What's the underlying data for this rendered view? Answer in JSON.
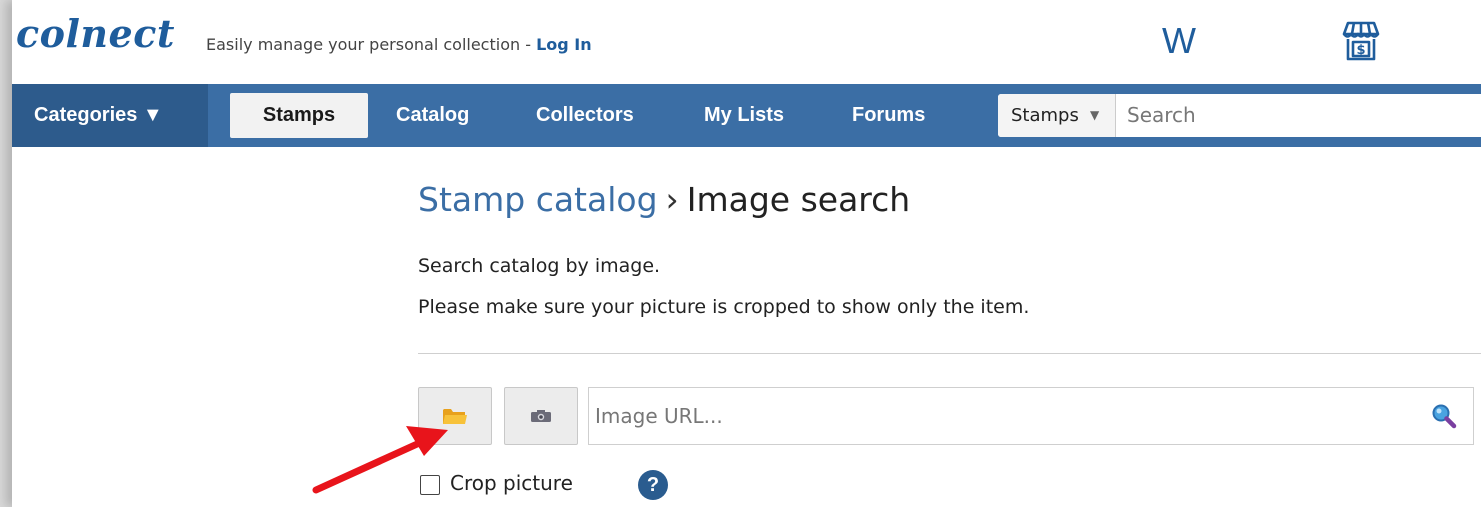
{
  "header": {
    "logo_text": "colnect",
    "tagline": "Easily manage your personal collection - ",
    "login_link": "Log In",
    "w_link": "W",
    "shop_icon": "shop-icon"
  },
  "nav": {
    "categories": "Categories ▼",
    "stamps": "Stamps",
    "catalog": "Catalog",
    "collectors": "Collectors",
    "my_lists": "My Lists",
    "forums": "Forums",
    "search_scope": "Stamps",
    "search_placeholder": "Search"
  },
  "main": {
    "breadcrumb_link": "Stamp catalog",
    "breadcrumb_sep": "›",
    "page_title": "Image search",
    "description_1": "Search catalog by image.",
    "description_2": "Please make sure your picture is cropped to show only the item.",
    "url_placeholder": "Image URL...",
    "crop_label": "Crop picture",
    "help_symbol": "?"
  },
  "colors": {
    "nav_bg": "#3b6ea5",
    "brand_blue": "#1f5d9c",
    "annotation_arrow": "#e8141b"
  }
}
